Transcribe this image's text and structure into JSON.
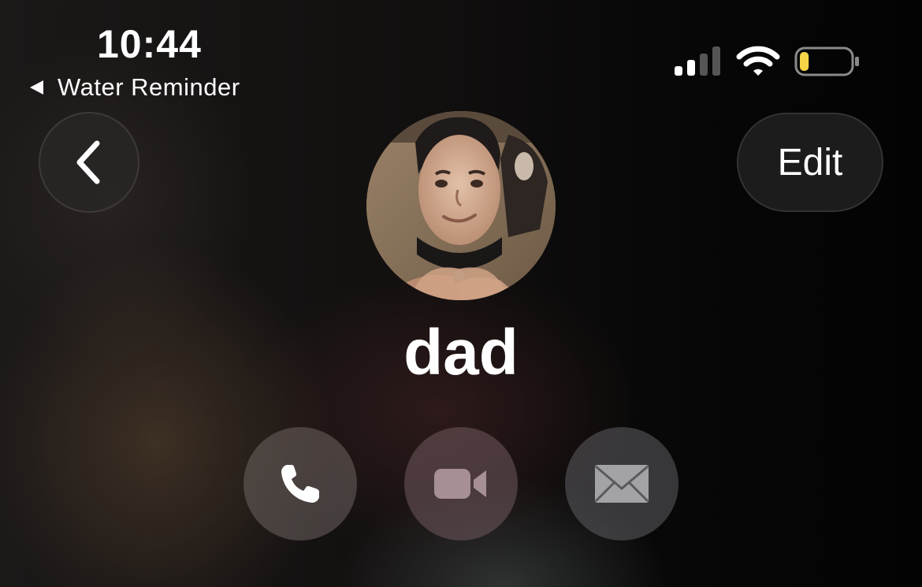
{
  "status_bar": {
    "time": "10:44",
    "back_app_label": "Water Reminder",
    "signal_icon": "cellular-signal-icon",
    "wifi_icon": "wifi-icon",
    "battery_icon": "battery-icon",
    "battery_level": 0.18,
    "battery_color": "#f5d547"
  },
  "navigation": {
    "back_icon": "chevron-left-icon",
    "edit_label": "Edit"
  },
  "contact": {
    "name": "dad",
    "avatar": "contact-photo"
  },
  "actions": [
    {
      "icon": "phone-icon",
      "enabled": true
    },
    {
      "icon": "video-camera-icon",
      "enabled": false
    },
    {
      "icon": "mail-icon",
      "enabled": false
    }
  ]
}
